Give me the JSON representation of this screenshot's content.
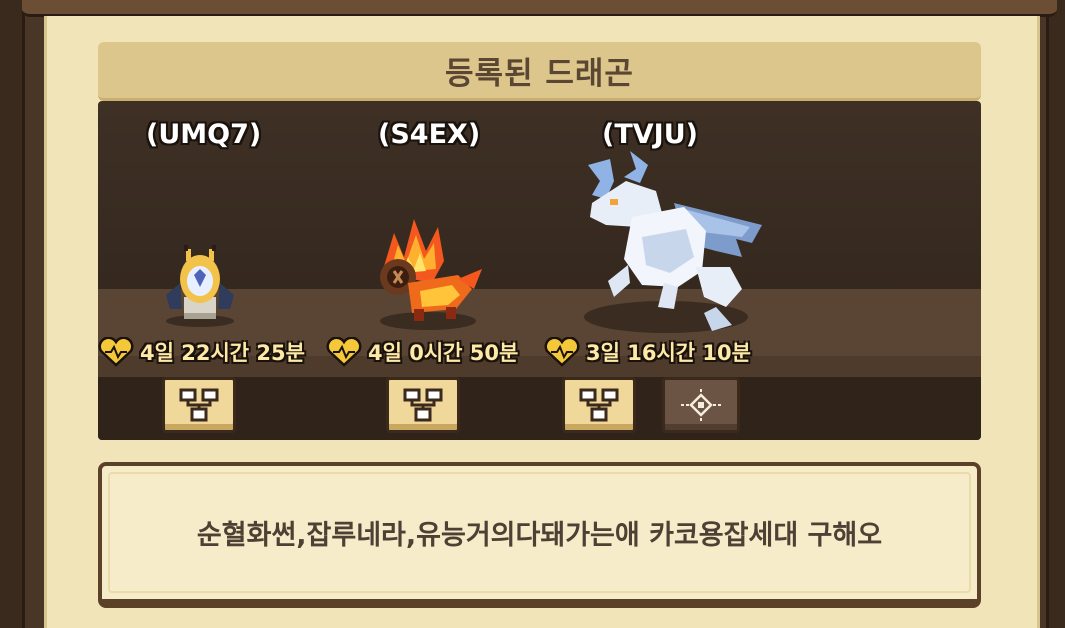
{
  "panel": {
    "title": "등록된 드래곤"
  },
  "dragons": [
    {
      "name": "(UMQ7)",
      "timer": "4일 22시간 25분",
      "icon": "egg-dragon-sprite",
      "button_icon": "tree-icon"
    },
    {
      "name": "(S4EX)",
      "timer": "4일 0시간 50분",
      "icon": "fire-dragon-sprite",
      "button_icon": "tree-icon"
    },
    {
      "name": "(TVJU)",
      "timer": "3일 16시간 10분",
      "icon": "white-dragon-sprite",
      "button_icon": "tree-icon",
      "extra_button_icon": "target-icon"
    }
  ],
  "message": {
    "text": "순혈화썬,잡루네라,유능거의다돼가는애 카코용잡세대 구해오"
  },
  "colors": {
    "panel_bg": "#f1e4b9",
    "title_bar": "#dcc68c",
    "stage_bg": "#35281e",
    "timer_text": "#ffe9a6",
    "heart": "#f5c83a"
  }
}
